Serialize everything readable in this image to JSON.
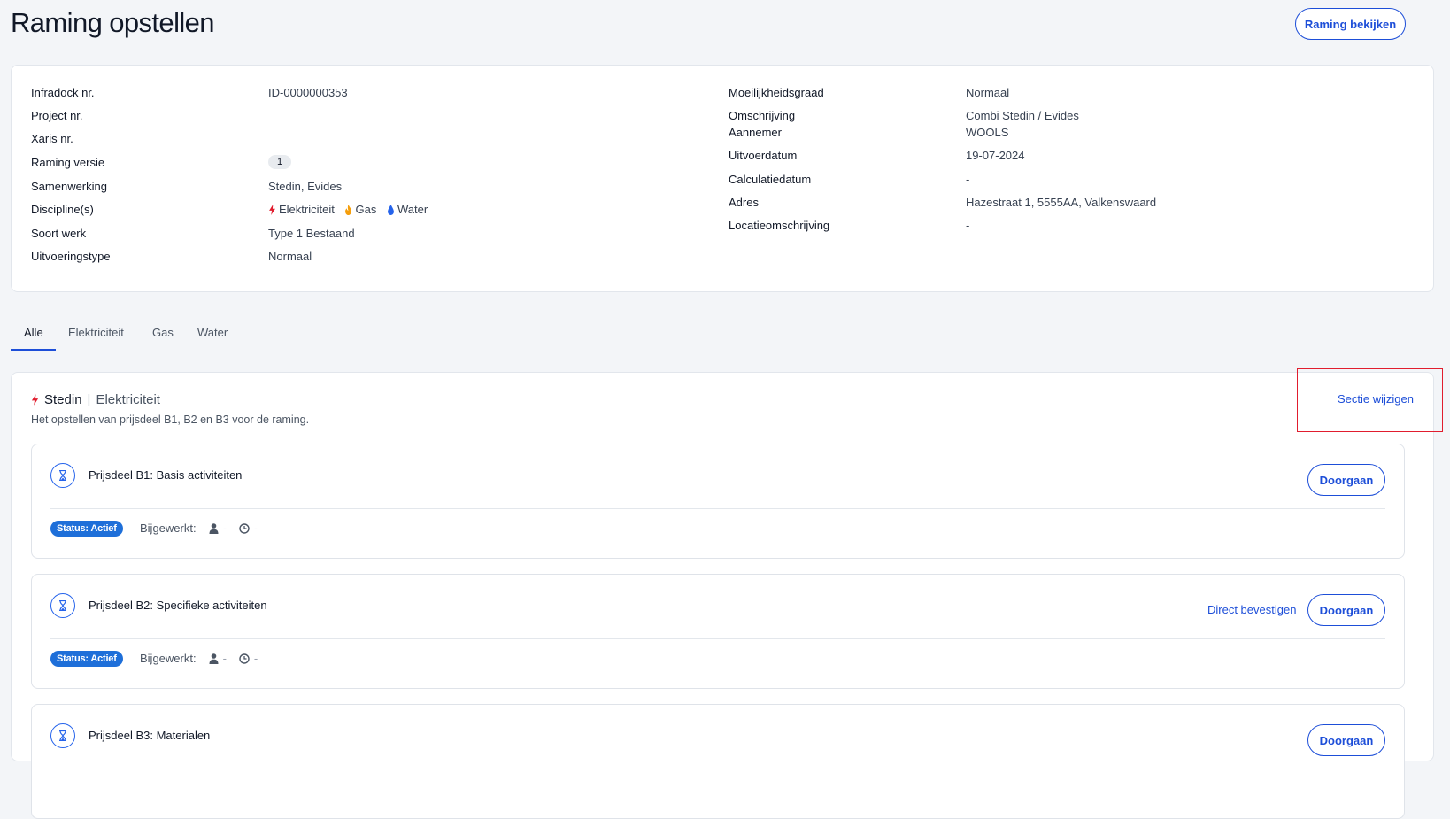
{
  "header": {
    "title": "Raming opstellen",
    "view_button": "Raming bekijken"
  },
  "info": {
    "left": [
      {
        "label": "Infradock nr.",
        "value": "ID-0000000353"
      },
      {
        "label": "Project nr.",
        "value": ""
      },
      {
        "label": "Xaris nr.",
        "value": ""
      },
      {
        "label": "Raming versie",
        "value": "1"
      },
      {
        "label": "Samenwerking",
        "value": "Stedin, Evides"
      },
      {
        "label": "Discipline(s)",
        "value": ""
      },
      {
        "label": "Soort werk",
        "value": "Type 1 Bestaand"
      },
      {
        "label": "Uitvoeringstype",
        "value": "Normaal"
      }
    ],
    "disciplines": [
      {
        "name": "Elektriciteit",
        "color": "#e11d2e"
      },
      {
        "name": "Gas",
        "color": "#f59e0b"
      },
      {
        "name": "Water",
        "color": "#2563eb"
      }
    ],
    "right": [
      {
        "label": "Moeilijkheidsgraad",
        "value": "Normaal"
      },
      {
        "label": "Omschrijving",
        "value": "Combi Stedin / Evides"
      },
      {
        "label": "Aannemer",
        "value": "WOOLS"
      },
      {
        "label": "Uitvoerdatum",
        "value": "19-07-2024"
      },
      {
        "label": "Calculatiedatum",
        "value": "-"
      },
      {
        "label": "Adres",
        "value": "Hazestraat 1, 5555AA, Valkenswaard"
      },
      {
        "label": "Locatieomschrijving",
        "value": "-"
      }
    ]
  },
  "tabs": [
    "Alle",
    "Elektriciteit",
    "Gas",
    "Water"
  ],
  "section": {
    "name": "Stedin",
    "separator": "|",
    "discipline": "Elektriciteit",
    "subtitle": "Het opstellen van prijsdeel B1, B2 en B3 voor de raming.",
    "edit": "Sectie wijzigen",
    "items": [
      {
        "title": "Prijsdeel B1: Basis activiteiten",
        "status": "Status: Actief",
        "updated_label": "Bijgewerkt:",
        "user": "-",
        "time": "-",
        "button": "Doorgaan"
      },
      {
        "title": "Prijsdeel B2: Specifieke activiteiten",
        "status": "Status: Actief",
        "updated_label": "Bijgewerkt:",
        "user": "-",
        "time": "-",
        "button": "Doorgaan",
        "link": "Direct bevestigen"
      },
      {
        "title": "Prijsdeel B3: Materialen",
        "button": "Doorgaan"
      }
    ]
  }
}
